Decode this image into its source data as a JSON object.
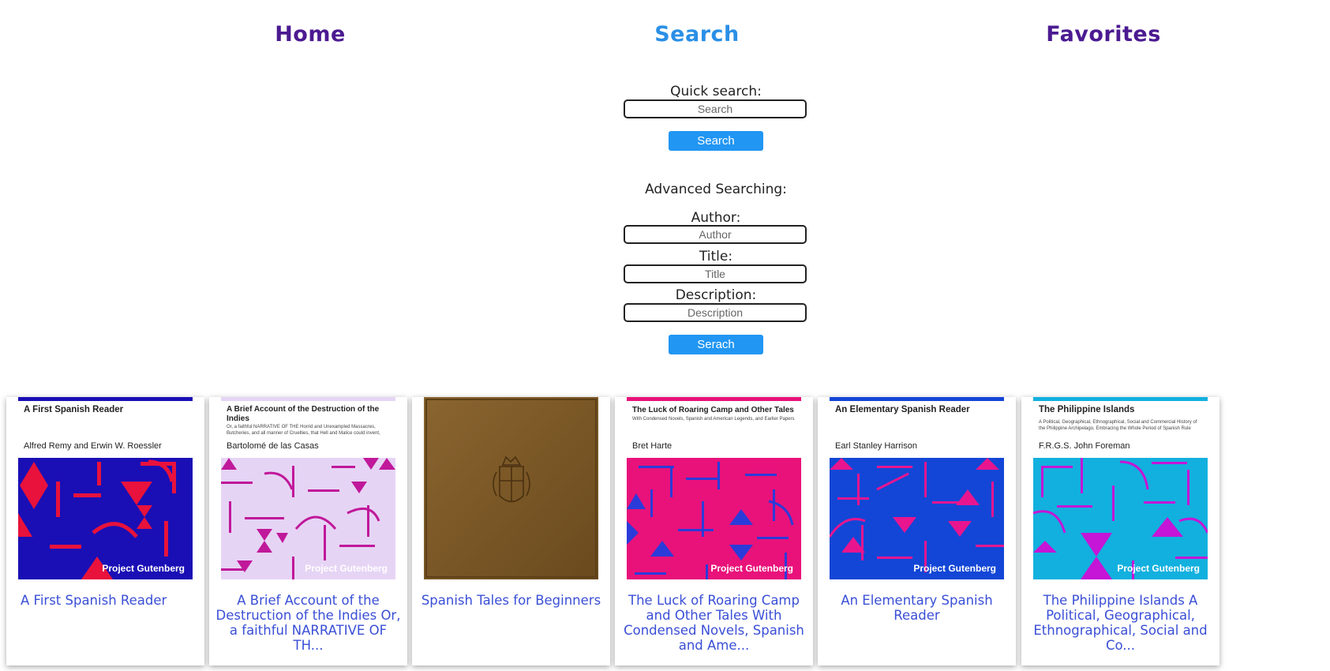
{
  "nav": {
    "home": "Home",
    "search": "Search",
    "favorites": "Favorites"
  },
  "quick_search": {
    "label": "Quick search:",
    "placeholder": "Search",
    "button": "Search"
  },
  "advanced": {
    "heading": "Advanced Searching:",
    "author_label": "Author:",
    "author_placeholder": "Author",
    "title_label": "Title:",
    "title_placeholder": "Title",
    "description_label": "Description:",
    "description_placeholder": "Description",
    "button": "Serach"
  },
  "books": [
    {
      "cover_title": "A First Spanish Reader",
      "cover_subtitle": "",
      "cover_author": "Alfred Remy and Erwin W. Roessler",
      "cover_publisher": "Project Gutenberg",
      "accent": "#1a0fb5",
      "art_bg": "#1a0fb5",
      "art_fg": "#e8123c",
      "caption": "A First Spanish Reader"
    },
    {
      "cover_title": "A Brief Account of the Destruction of the Indies",
      "cover_subtitle": "Or, a faithful NARRATIVE OF THE Horrid and Unexampled Massacres, Butcheries, and all manner of Cruelties, that Hell and Malice could invent,",
      "cover_author": "Bartolomé de las Casas",
      "cover_publisher": "Project Gutenberg",
      "accent": "#e6d4f5",
      "art_bg": "#e6d4f5",
      "art_fg": "#c0189a",
      "caption": "A Brief Account of the Destruction of the Indies Or, a faithful NARRATIVE OF TH..."
    },
    {
      "cover_title": "",
      "cover_subtitle": "",
      "cover_author": "",
      "cover_publisher": "",
      "accent": "#7d5a2a",
      "art_bg": "#7d5a2a",
      "art_fg": "#5a3d18",
      "caption": "Spanish Tales for Beginners"
    },
    {
      "cover_title": "The Luck of Roaring Camp and Other Tales",
      "cover_subtitle": "With Condensed Novels, Spanish and American Legends, and Earlier Papers",
      "cover_author": "Bret Harte",
      "cover_publisher": "Project Gutenberg",
      "accent": "#e8127a",
      "art_bg": "#e8127a",
      "art_fg": "#2b3bd9",
      "caption": "The Luck of Roaring Camp and Other Tales With Condensed Novels, Spanish and Ame..."
    },
    {
      "cover_title": "An Elementary Spanish Reader",
      "cover_subtitle": "",
      "cover_author": "Earl Stanley Harrison",
      "cover_publisher": "Project Gutenberg",
      "accent": "#1346d6",
      "art_bg": "#1346d6",
      "art_fg": "#e8158f",
      "caption": "An Elementary Spanish Reader"
    },
    {
      "cover_title": "The Philippine Islands",
      "cover_subtitle": "A Political, Geographical, Ethnographical, Social and Commercial History of the Philippine Archipelago, Embracing the Whole Period of Spanish Rule",
      "cover_author": "F.R.G.S. John Foreman",
      "cover_publisher": "Project Gutenberg",
      "accent": "#12b0de",
      "art_bg": "#12b0de",
      "art_fg": "#c515d6",
      "caption": "The Philippine Islands A Political, Geographical, Ethnographical, Social and Co..."
    }
  ]
}
